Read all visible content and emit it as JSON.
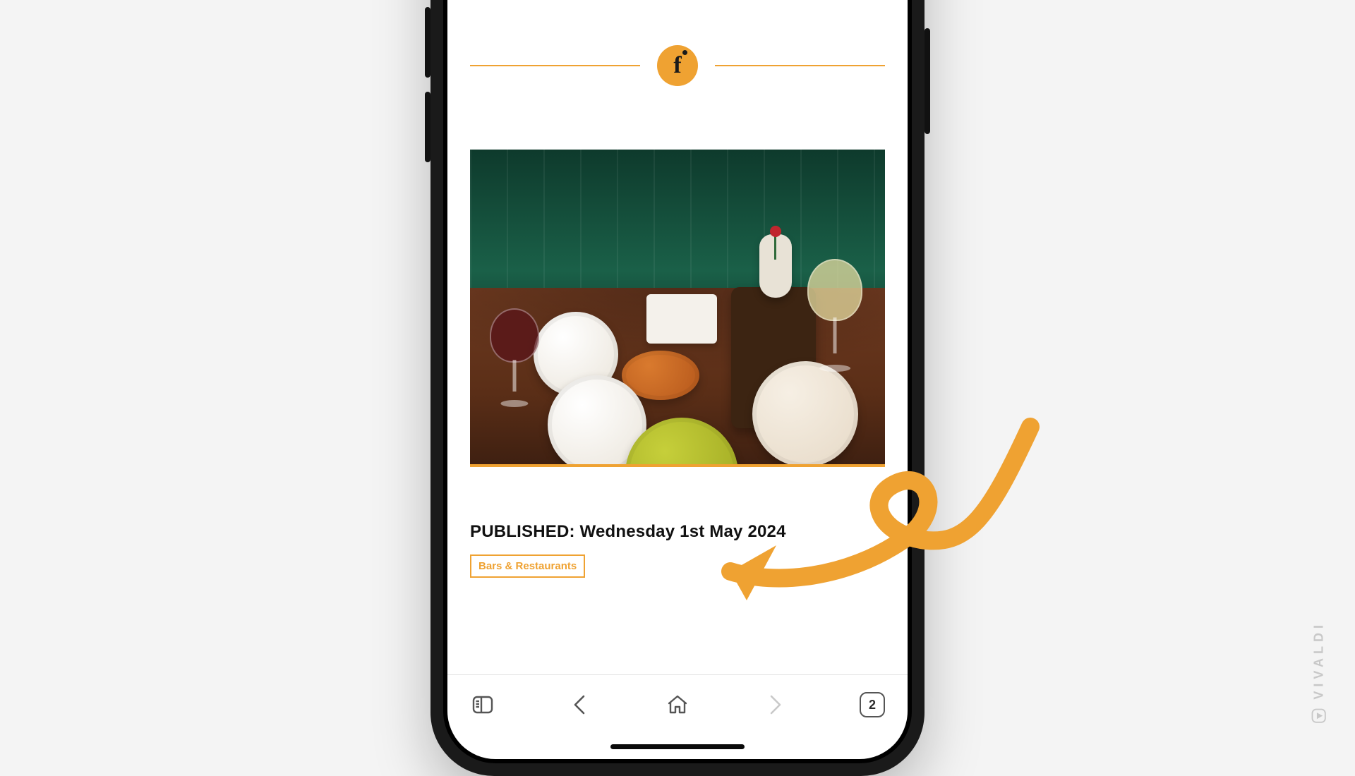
{
  "brand": {
    "letter": "f"
  },
  "article": {
    "published_label": "PUBLISHED: Wednesday 1st May 2024",
    "category_tag": "Bars & Restaurants"
  },
  "toolbar": {
    "panel_label": "panel",
    "back_label": "back",
    "forward_label": "forward",
    "home_label": "home",
    "tab_count": "2"
  },
  "watermark": {
    "text": "VIVALDI"
  },
  "colors": {
    "accent": "#efa232",
    "booth_green": "#14543f",
    "table_wood": "#5a2e17"
  }
}
